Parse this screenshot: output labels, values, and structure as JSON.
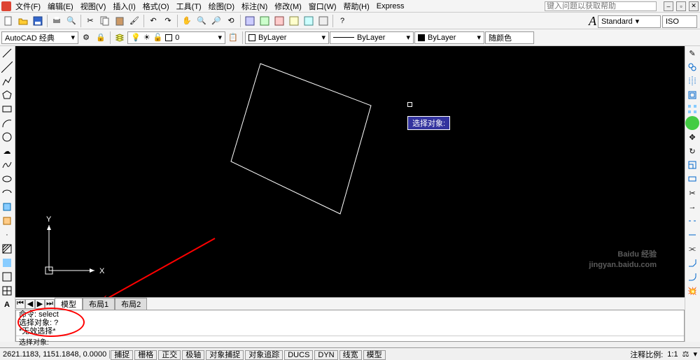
{
  "menu": {
    "file": "文件(F)",
    "edit": "编辑(E)",
    "view": "视图(V)",
    "insert": "插入(I)",
    "format": "格式(O)",
    "tools": "工具(T)",
    "draw": "绘图(D)",
    "dimension": "标注(N)",
    "modify": "修改(M)",
    "window": "窗口(W)",
    "help": "帮助(H)",
    "express": "Express"
  },
  "search_placeholder": "键入问题以获取帮助",
  "workspace": "AutoCAD 经典",
  "properties": {
    "layer": "0",
    "bylayer1": "ByLayer",
    "bylayer2": "ByLayer",
    "bylayer3": "ByLayer",
    "colorlabel": "随颜色"
  },
  "textstyle": {
    "standard": "Standard",
    "iso": "ISO"
  },
  "tooltip": "选择对象:",
  "ucs": {
    "x": "X",
    "y": "Y"
  },
  "tabs": {
    "model": "模型",
    "layout1": "布局1",
    "layout2": "布局2"
  },
  "commandline": {
    "line1": "命令: select",
    "line2": "选择对象: ?",
    "line3": "*无效选择*",
    "prompt": "选择对象:"
  },
  "statusbar": {
    "coords": "2621.1183, 1151.1848, 0.0000",
    "buttons": [
      "捕捉",
      "栅格",
      "正交",
      "极轴",
      "对象捕捉",
      "对象追踪",
      "DUCS",
      "DYN",
      "线宽",
      "模型"
    ],
    "annoscale_label": "注释比例:",
    "annoscale": "1:1"
  },
  "watermark": {
    "main": "Baidu 经验",
    "sub": "jingyan.baidu.com"
  }
}
